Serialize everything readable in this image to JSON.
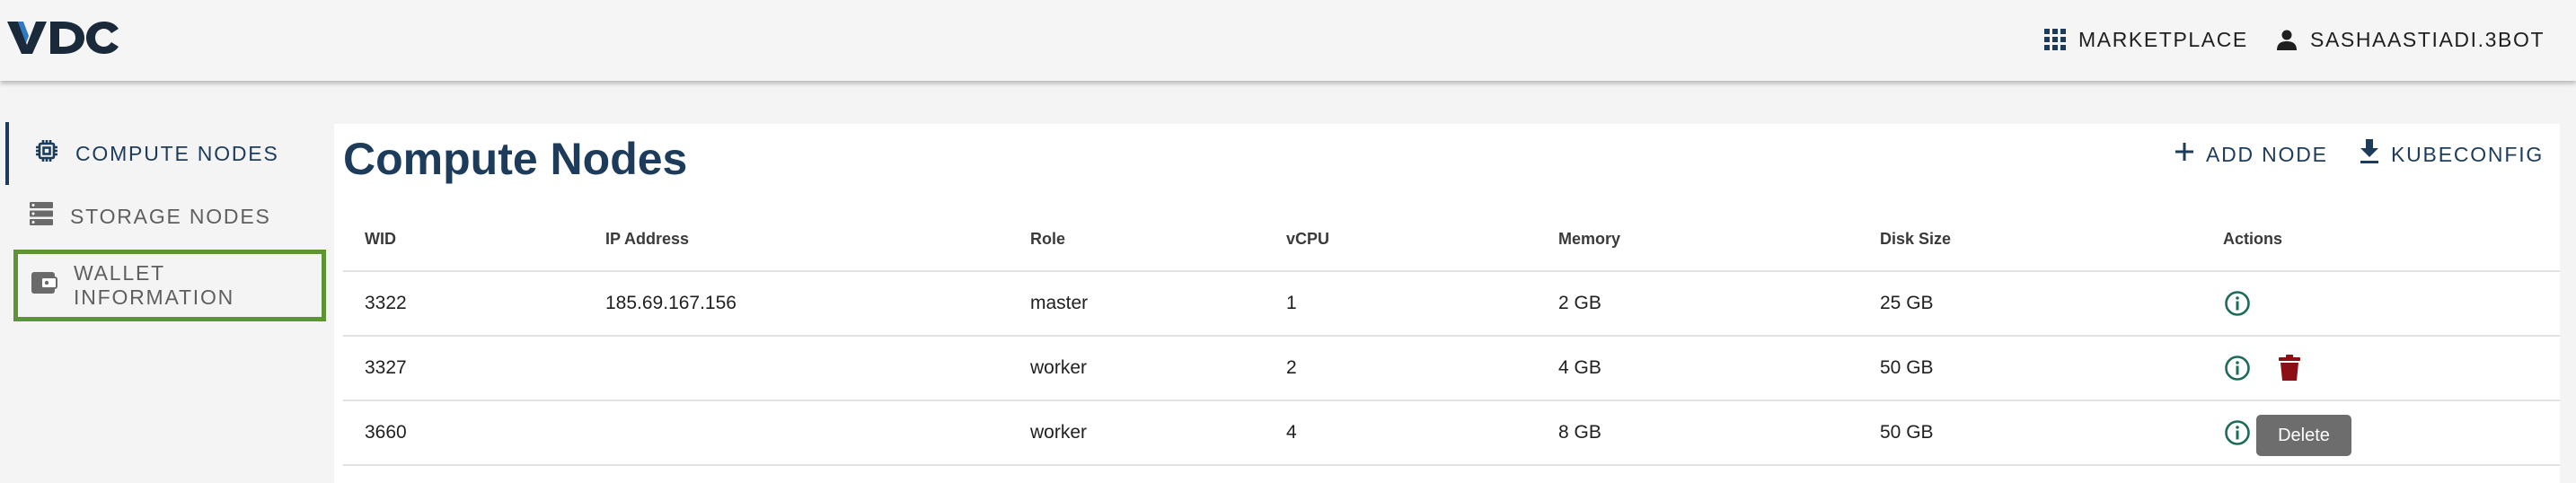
{
  "header": {
    "logo_text": "VDC",
    "marketplace_label": "MARKETPLACE",
    "user_label": "SASHAASTIADI.3BOT"
  },
  "sidebar": {
    "items": [
      {
        "label": "COMPUTE NODES",
        "icon": "cpu-icon",
        "active": true
      },
      {
        "label": "STORAGE NODES",
        "icon": "storage-icon",
        "active": false
      },
      {
        "label": "WALLET INFORMATION",
        "icon": "wallet-icon",
        "active": false,
        "highlighted": true
      }
    ]
  },
  "main": {
    "title": "Compute Nodes",
    "add_node_label": "ADD NODE",
    "kubeconfig_label": "KUBECONFIG",
    "table": {
      "columns": [
        "WID",
        "IP Address",
        "Role",
        "vCPU",
        "Memory",
        "Disk Size",
        "Actions"
      ],
      "rows": [
        {
          "wid": "3322",
          "ip": "185.69.167.156",
          "role": "master",
          "vcpu": "1",
          "memory": "2 GB",
          "disk": "25 GB",
          "can_delete": false
        },
        {
          "wid": "3327",
          "ip": "",
          "role": "worker",
          "vcpu": "2",
          "memory": "4 GB",
          "disk": "50 GB",
          "can_delete": true
        },
        {
          "wid": "3660",
          "ip": "",
          "role": "worker",
          "vcpu": "4",
          "memory": "8 GB",
          "disk": "50 GB",
          "can_delete": true
        }
      ]
    },
    "tooltip": "Delete"
  },
  "colors": {
    "primary": "#1d3b5a",
    "highlight_border": "#5c9531",
    "info_icon": "#1e6b5c",
    "delete_icon": "#8b0f14",
    "tooltip_bg": "#6d6d6d"
  }
}
